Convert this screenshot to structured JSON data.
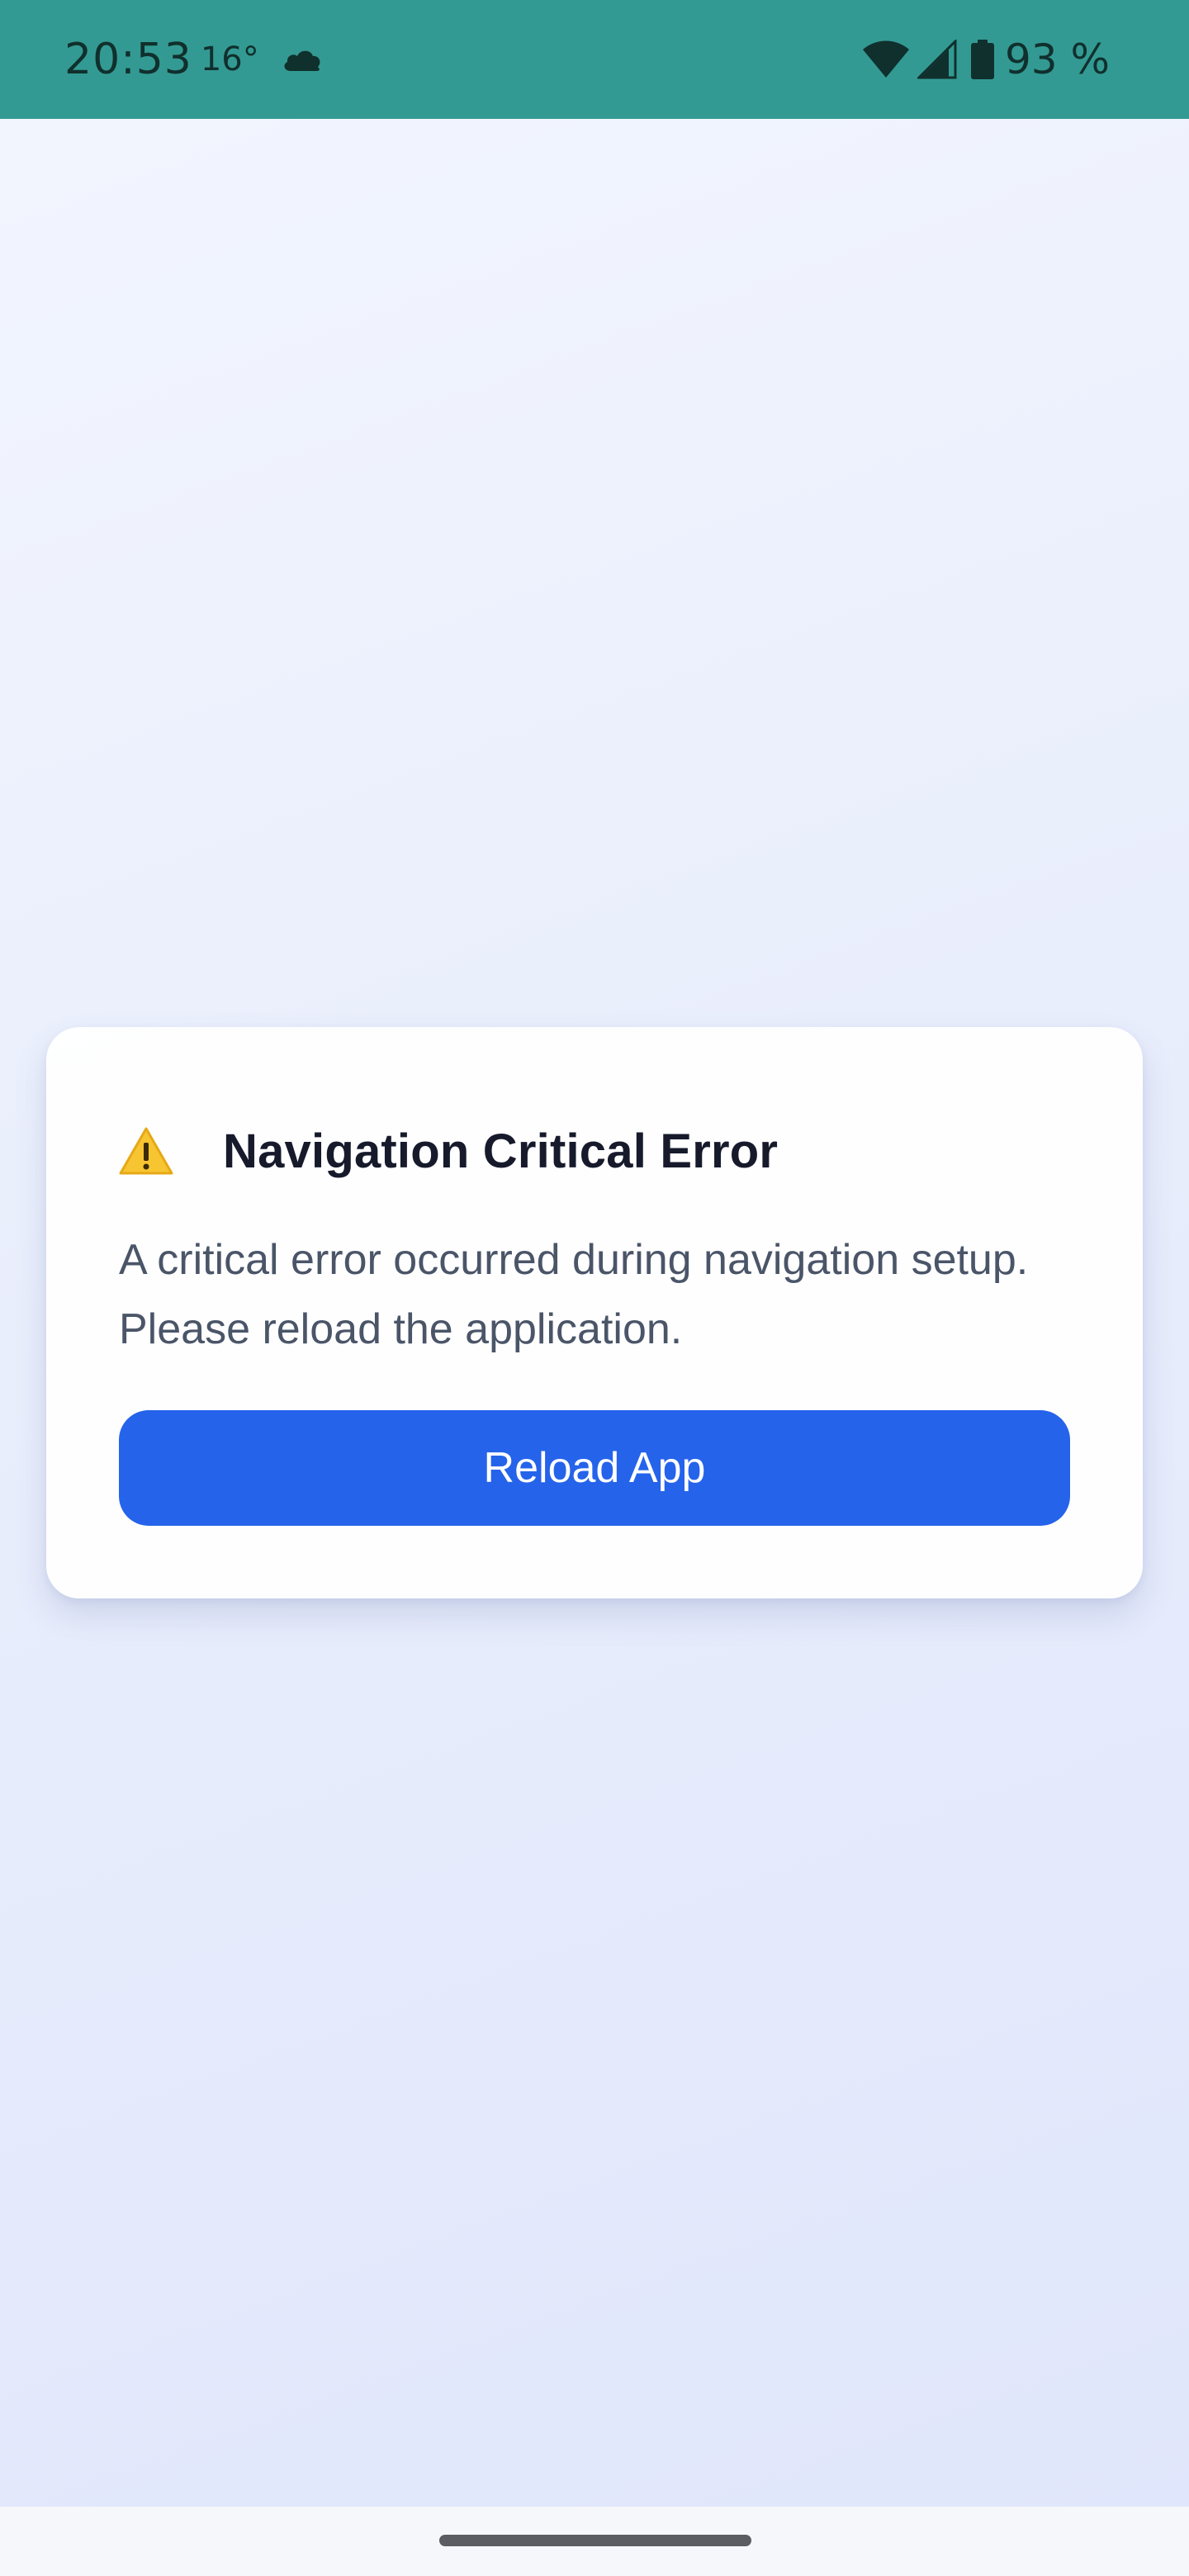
{
  "status_bar": {
    "time": "20:53",
    "temperature": "16°",
    "weather_icon": "cloud-icon",
    "battery": "93 %",
    "background_color": "#339a93"
  },
  "error_card": {
    "icon": "warning-icon",
    "title": "Navigation Critical Error",
    "message": "A critical error occurred during navigation setup. Please reload the application.",
    "button_label": "Reload App",
    "button_color": "#2563eb"
  }
}
